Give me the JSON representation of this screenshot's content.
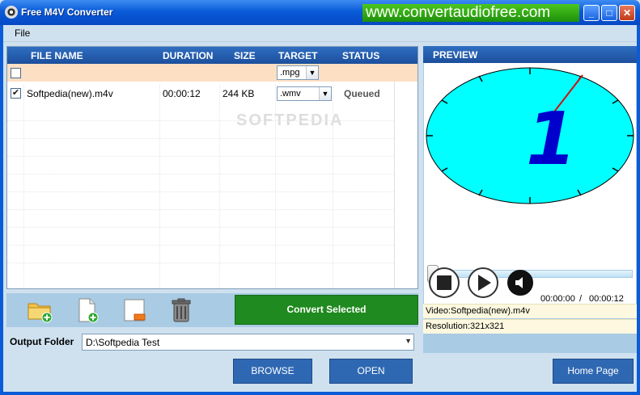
{
  "window": {
    "title": "Free M4V Converter",
    "banner": "www.convertaudiofree.com",
    "btn_min": "_",
    "btn_max": "□",
    "btn_close": "✕"
  },
  "menu": {
    "file": "File"
  },
  "table": {
    "headers": [
      "FILE NAME",
      "DURATION",
      "SIZE",
      "TARGET",
      "STATUS"
    ],
    "default_target": ".mpg",
    "rows": [
      {
        "checked": "✔",
        "name": "Softpedia(new).m4v",
        "duration": "00:00:12",
        "size": "244 KB",
        "target": ".wmv",
        "status": "Queued"
      }
    ]
  },
  "watermark": "SOFTPEDIA",
  "toolbar": {
    "icons": [
      "add-folder-icon",
      "add-file-icon",
      "remove-file-icon",
      "trash-icon"
    ],
    "convert_label": "Convert Selected"
  },
  "output": {
    "label": "Output Folder",
    "value": "D:\\Softpedia Test",
    "browse_label": "BROWSE",
    "open_label": "OPEN"
  },
  "preview": {
    "header": "PREVIEW",
    "time_current": "00:00:00",
    "time_sep": "/",
    "time_total": "00:00:12",
    "progress": 0,
    "clock_digit": "1",
    "video_info": "Video:Softpedia(new).m4v",
    "resolution_info": "Resolution:321x321"
  },
  "home_page_label": "Home Page",
  "colors": {
    "accent_green": "#1f8a1f",
    "header_blue": "#2f6ec1",
    "preview_face": "#00ffff",
    "row_highlight": "#fddfc4"
  }
}
